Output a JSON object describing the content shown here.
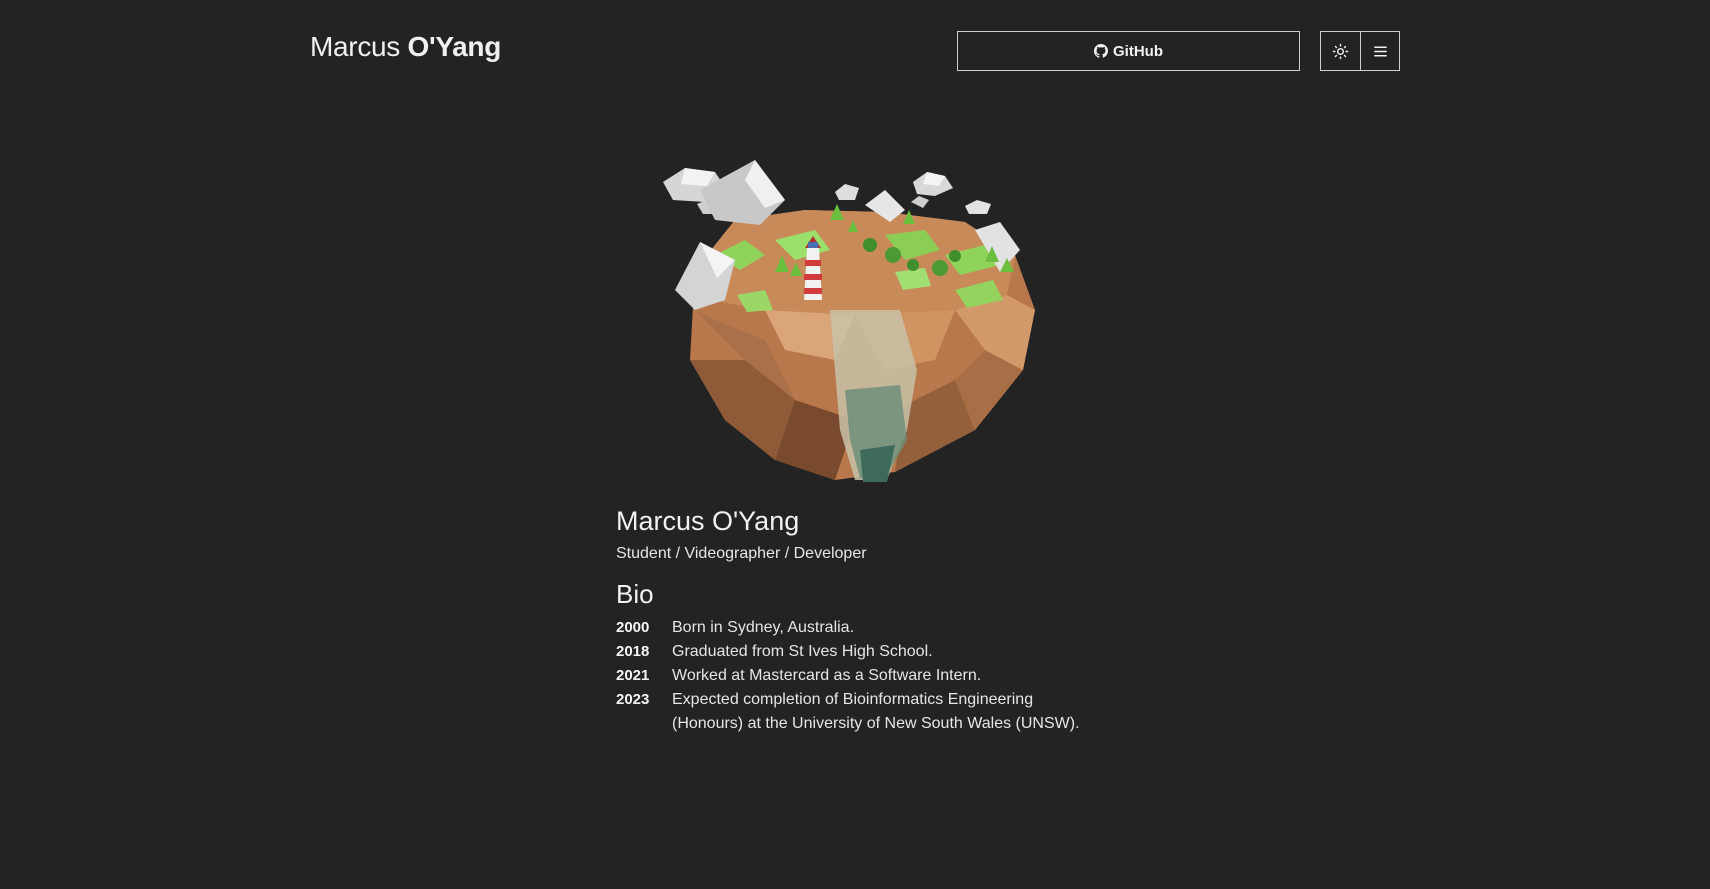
{
  "header": {
    "brand_first": "Marcus",
    "brand_last": "O'Yang",
    "github_label": "GitHub",
    "icons": [
      "github-icon",
      "sun-icon",
      "menu-icon"
    ]
  },
  "profile": {
    "name": "Marcus O'Yang",
    "subtitle": "Student / Videographer / Developer"
  },
  "bio": {
    "heading": "Bio",
    "items": [
      {
        "year": "2000",
        "text": "Born in Sydney, Australia."
      },
      {
        "year": "2018",
        "text": "Graduated from St Ives High School."
      },
      {
        "year": "2021",
        "text": "Worked at Mastercard as a Software Intern."
      },
      {
        "year": "2023",
        "text": "Expected completion of Bioinformatics Engineering (Honours) at the University of New South Wales (UNSW)."
      }
    ]
  },
  "colors": {
    "background": "#232323",
    "text": "#e6e6e6",
    "border": "#cfcfcf",
    "rock": "#c98a5a",
    "grass": "#8fd35a",
    "snow": "#e8e8e8"
  }
}
